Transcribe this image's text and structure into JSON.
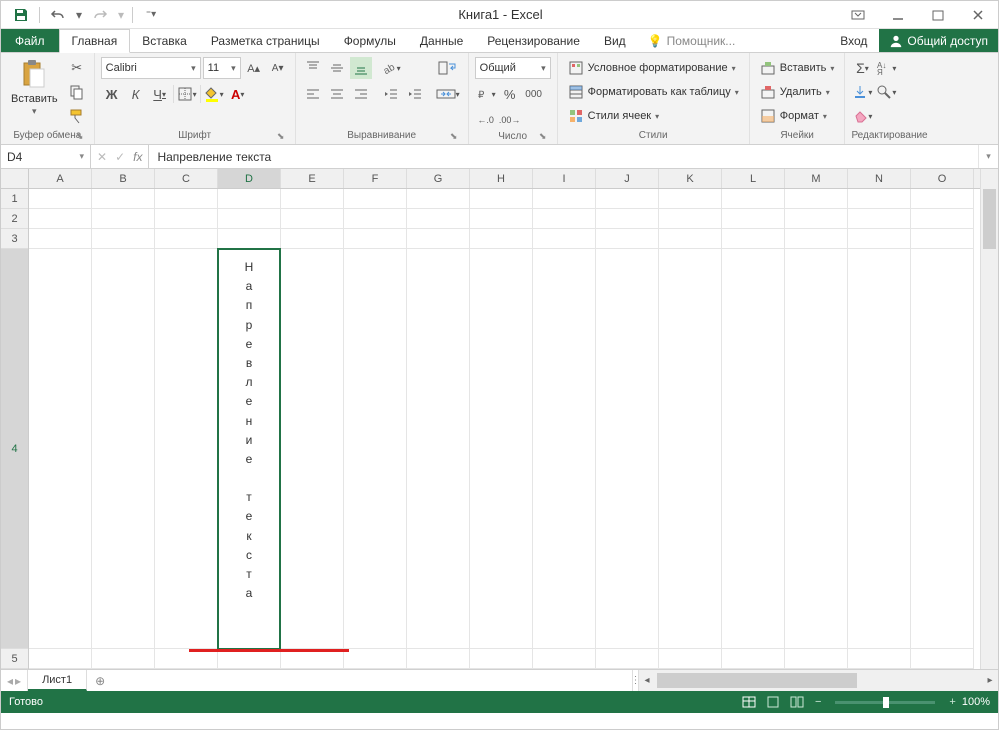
{
  "title": "Книга1 - Excel",
  "tabs": {
    "file": "Файл",
    "home": "Главная",
    "insert": "Вставка",
    "page_layout": "Разметка страницы",
    "formulas": "Формулы",
    "data": "Данные",
    "review": "Рецензирование",
    "view": "Вид",
    "tell_me": "Помощник...",
    "sign_in": "Вход",
    "share": "Общий доступ"
  },
  "ribbon": {
    "clipboard": {
      "label": "Буфер обмена",
      "paste": "Вставить"
    },
    "font": {
      "label": "Шрифт",
      "name": "Calibri",
      "size": "11",
      "bold": "Ж",
      "italic": "К",
      "underline": "Ч"
    },
    "alignment": {
      "label": "Выравнивание"
    },
    "number": {
      "label": "Число",
      "format": "Общий"
    },
    "styles": {
      "label": "Стили",
      "cond_format": "Условное форматирование",
      "format_table": "Форматировать как таблицу",
      "cell_styles": "Стили ячеек"
    },
    "cells": {
      "label": "Ячейки",
      "insert": "Вставить",
      "delete": "Удалить",
      "format": "Формат"
    },
    "editing": {
      "label": "Редактирование"
    }
  },
  "name_box": "D4",
  "formula": "Напревление текста",
  "columns": [
    "A",
    "B",
    "C",
    "D",
    "E",
    "F",
    "G",
    "H",
    "I",
    "J",
    "K",
    "L",
    "M",
    "N",
    "O"
  ],
  "rows": [
    "1",
    "2",
    "3",
    "4",
    "5"
  ],
  "cell_text": "Напревление текста",
  "sheet": {
    "tab": "Лист1"
  },
  "status": {
    "ready": "Готово",
    "zoom": "100%"
  }
}
